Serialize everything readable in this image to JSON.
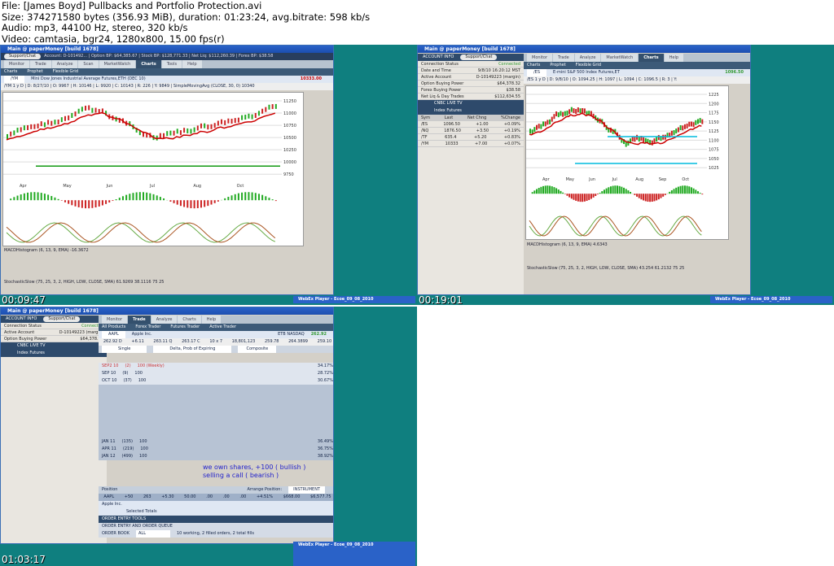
{
  "header": {
    "lines": [
      "File: [James Boyd] Pullbacks and Portfolio Protection.avi",
      "Size: 374271580 bytes (356.93 MiB), duration: 01:23:24, avg.bitrate: 598 kb/s",
      "Audio: mp3, 44100 Hz, stereo, 320 kb/s",
      "Video: camtasia, bgr24, 1280x800, 15.00 fps(r)"
    ]
  },
  "app": {
    "title": "Main @ paperMoney [build 1678]",
    "support": "Support/Chat",
    "tabs": [
      "Monitor",
      "Trade",
      "Analyze",
      "Scan",
      "MarketWatch",
      "Charts",
      "Tools",
      "Help"
    ],
    "chart_subtabs": [
      "Charts",
      "Prophet",
      "Flexible Grid"
    ],
    "trade_subtabs": [
      "All Products",
      "Forex Trader",
      "Futures Trader",
      "Active Trader"
    ],
    "webex": "WebEx Player - Ecoe_09_08_2010"
  },
  "thumbs": [
    {
      "timestamp": "00:09:47",
      "account_bar": "Account: D-101492... | Option BP: $64,385.67 | Stock BP: $128,771.33 | Net Liq: $112,260.39 | Forex BP: $38.58",
      "symbol": "/YM",
      "desc": "Mini Dow Jones Industrial Average Futures,ETH (DEC 10)",
      "last": "10333.00",
      "bar": "/YM 1 y D | D: 8/27/10 | O: 9967 | H: 10146 | L: 9920 | C: 10143 | R: 226 | Y: 9849 | SimpleMovingAvg (CLOSE, 30, 0) 10340",
      "yticks": [
        "11250",
        "11000",
        "10750",
        "10500",
        "10250",
        "10000",
        "9750"
      ],
      "months": [
        "Apr",
        "May",
        "Jun",
        "Jul",
        "Aug",
        "Oct"
      ],
      "macd": "MACDHistogram (6, 13, 9, EMA) -16.3672",
      "stoch": "StochasticSlow (75, 25, 3, 2, HIGH, LOW, CLOSE, SMA) 61.9269 38.1116 75 25"
    },
    {
      "timestamp": "00:19:01",
      "symbol": "/ES",
      "desc": "E-mini S&P 500 Index Futures,ET",
      "last": "1096.50",
      "bar": "/ES 1 y D | D: 9/8/10 | O: 1094.25 | H: 1097 | L: 1094 | C: 1096.5 | R: 3 | Y:",
      "yticks": [
        "1225",
        "1200",
        "1175",
        "1150",
        "1125",
        "1100",
        "1075",
        "1050",
        "1025"
      ],
      "months": [
        "Apr",
        "May",
        "Jun",
        "Jul",
        "Aug",
        "Sep",
        "Oct"
      ],
      "macd": "MACDHistogram (6, 13, 9, EMA) 4.6343",
      "stoch": "StochasticSlow (75, 25, 3, 2, HIGH, LOW, CLOSE, SMA) 43.254 61.2132 75 25"
    },
    {
      "timestamp": "01:03:17",
      "symbol": "AAPL",
      "desc": "Apple Inc.",
      "exchange": "ETB NASDAQ",
      "last": "262.92",
      "underlying": [
        "262.92 D",
        "+6.11",
        "263.11 Q",
        "263.17 C",
        "10 x 7",
        "18,801,123",
        "259.78",
        "264.3899",
        "259.10"
      ],
      "layout": "Delta, Prob of Expiring",
      "spread": "Single",
      "exch": "Composite",
      "expirations": [
        [
          "SEP2 10",
          "(2)",
          "100 (Weekly)",
          "34.17%"
        ],
        [
          "SEP 10",
          "(9)",
          "100",
          "28.72%"
        ],
        [
          "OCT 10",
          "(37)",
          "100",
          "30.67%"
        ],
        [
          "JAN 11",
          "(135)",
          "100",
          "36.49%"
        ],
        [
          "APR 11",
          "(219)",
          "100",
          "36.75%"
        ],
        [
          "JAN 12",
          "(499)",
          "100",
          "38.92%"
        ]
      ],
      "note1": "we own shares, +100 ( bullish )",
      "note2": "selling a call ( bearish )",
      "position": {
        "label": "Position",
        "arrange": "Arrange Position:",
        "arrange_val": "INSTRUMENT",
        "row": [
          "AAPL",
          "+50",
          "263",
          "+5.30",
          "50.00",
          ".00",
          ".00",
          ".00",
          "+4.51%",
          "$668.00",
          "$6,577.75"
        ],
        "sub": "Apple Inc.",
        "totals": "Selected Totals"
      },
      "order": {
        "head": "ORDER ENTRY TOOLS",
        "queue": "ORDER ENTRY AND ORDER QUEUE",
        "book": "ORDER BOOK",
        "book_val": "ALL",
        "status": "10 working, 2 filled orders, 2 total fills"
      }
    }
  ],
  "sidebar": {
    "title": "ACCOUNT INFO",
    "rows": [
      [
        "Connection Status",
        "Connected"
      ],
      [
        "Date and Time",
        "9/8/10 16:20:12 MST"
      ],
      [
        "Active Account",
        "D-10149223 (margin)"
      ],
      [
        "Option Buying Power",
        "$64,378.32"
      ],
      [
        "Forex Buying Power",
        "$38.58"
      ],
      [
        "Net Liq & Day Trades",
        "$112,634.55"
      ]
    ],
    "cnbc": "CNBC LIVE TV",
    "futures": "Index Futures",
    "cols": [
      "Sym",
      "Last",
      "Net Chng",
      "%Change"
    ],
    "quotes": [
      [
        "/ES",
        "1096.50",
        "+1.00",
        "+0.09%"
      ],
      [
        "/NQ",
        "1876.50",
        "+3.50",
        "+0.19%"
      ],
      [
        "/TF",
        "635.4",
        "+5.20",
        "+0.83%"
      ],
      [
        "/YM",
        "10333",
        "+7.00",
        "+0.07%"
      ]
    ]
  }
}
